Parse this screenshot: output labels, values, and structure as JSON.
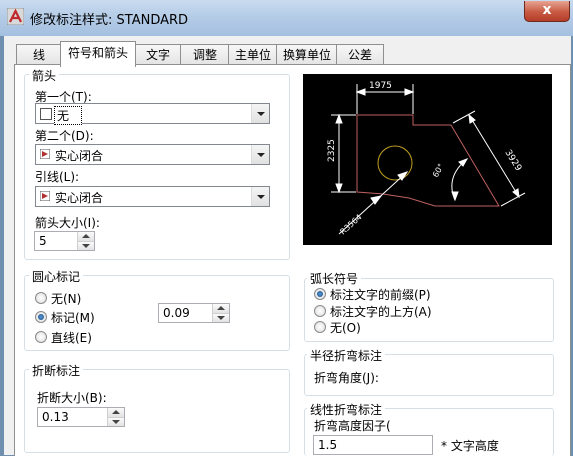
{
  "window": {
    "title": "修改标注样式: STANDARD",
    "close_label": "x"
  },
  "tabs": [
    {
      "label": "线"
    },
    {
      "label": "符号和箭头"
    },
    {
      "label": "文字"
    },
    {
      "label": "调整"
    },
    {
      "label": "主单位"
    },
    {
      "label": "换算单位"
    },
    {
      "label": "公差"
    }
  ],
  "arrowheads": {
    "title": "箭头",
    "first_label": "第一个(T):",
    "first_value": "无",
    "second_label": "第二个(D):",
    "second_value": "实心闭合",
    "leader_label": "引线(L):",
    "leader_value": "实心闭合",
    "size_label": "箭头大小(I):",
    "size_value": "5"
  },
  "center_marks": {
    "title": "圆心标记",
    "options": [
      "无(N)",
      "标记(M)",
      "直线(E)"
    ],
    "selected": "标记(M)",
    "size_value": "0.09"
  },
  "dim_break": {
    "title": "折断标注",
    "size_label": "折断大小(B):",
    "size_value": "0.13"
  },
  "arc_symbol": {
    "title": "弧长符号",
    "options": [
      "标注文字的前缀(P)",
      "标注文字的上方(A)",
      "无(O)"
    ],
    "selected": "标注文字的前缀(P)"
  },
  "radius_jog": {
    "title": "半径折弯标注",
    "angle_label": "折弯角度(J):"
  },
  "linear_jog": {
    "title": "线性折弯标注",
    "height_label": "折弯高度因子(",
    "height_value": "1.5",
    "text_height_label": "* 文字高度"
  },
  "preview": {
    "dim_top": "1975",
    "dim_left": "2325",
    "dim_right": "3929",
    "dim_angle": "60°",
    "dim_radius": "R3564"
  },
  "colors": {
    "preview_bg": "#000000",
    "preview_shape": "#c06060",
    "preview_dim": "#ffffff",
    "arrow_swatch": "#b03030"
  }
}
